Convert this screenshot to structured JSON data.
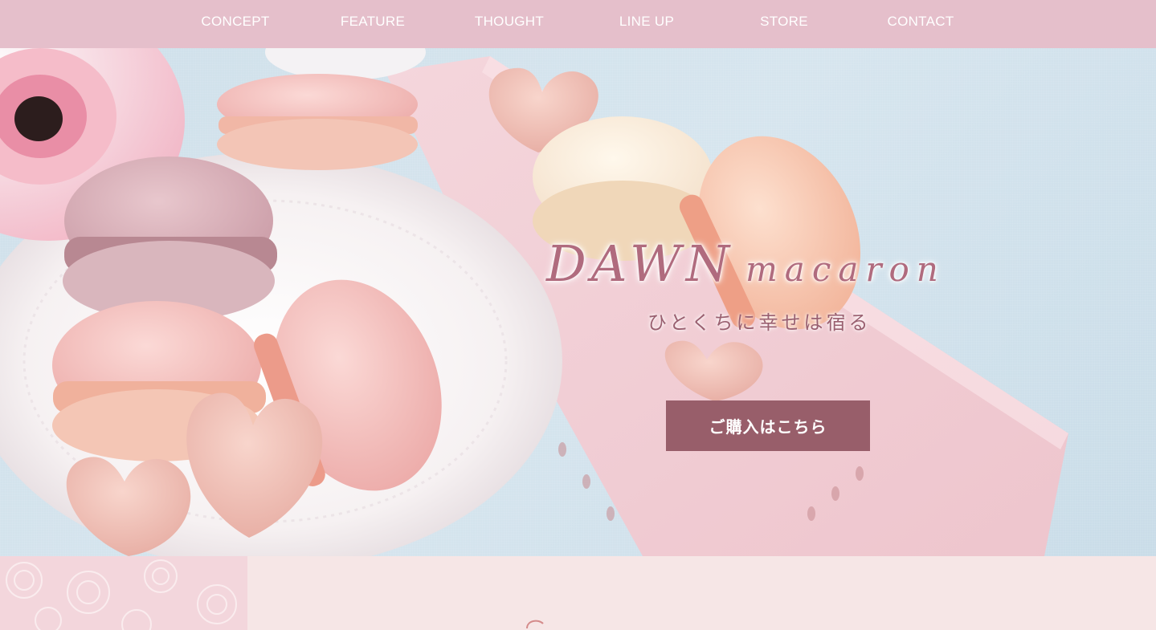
{
  "nav": {
    "items": [
      {
        "label": "CONCEPT"
      },
      {
        "label": "FEATURE"
      },
      {
        "label": "THOUGHT"
      },
      {
        "label": "LINE UP"
      },
      {
        "label": "STORE"
      },
      {
        "label": "CONTACT"
      }
    ]
  },
  "hero": {
    "brand_main": "DAWN",
    "brand_sub": "macaron",
    "tagline": "ひとくちに幸せは宿る",
    "buy_button": "ご購入はこちら"
  },
  "colors": {
    "nav_bg": "#e5bfcb",
    "button_bg": "#985e6a",
    "section_bg": "#f6e6e6",
    "brand_text": "#b06b7e"
  }
}
